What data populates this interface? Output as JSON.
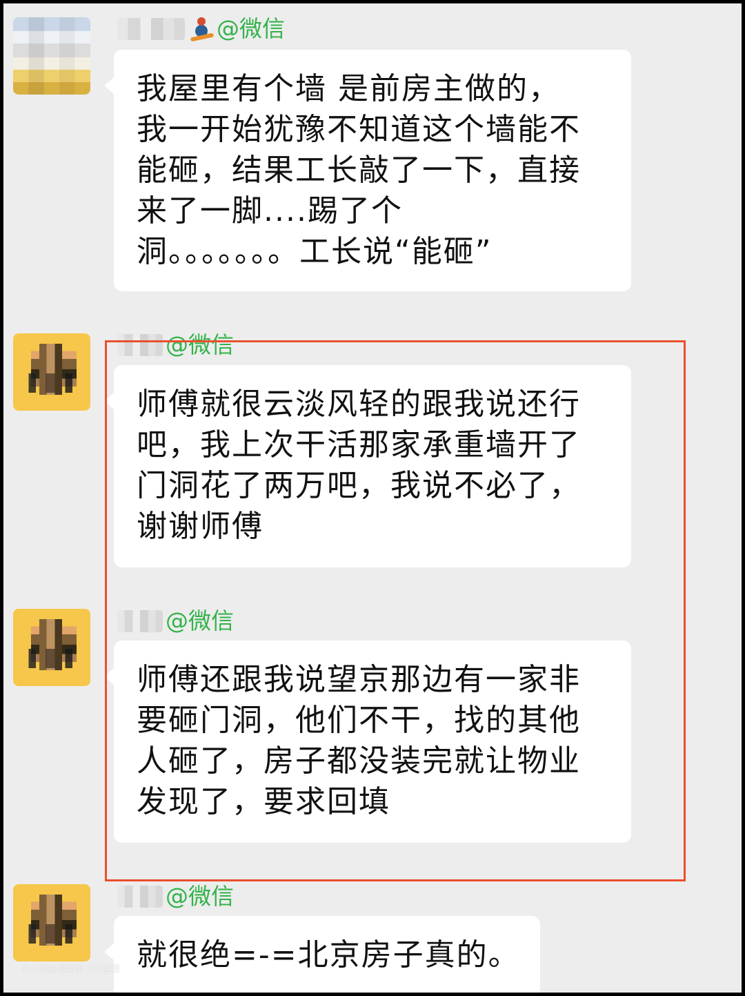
{
  "chat": {
    "wechat_tag": "@微信",
    "messages": [
      {
        "lines": [
          "我屋里有个墙 是前房主做的，",
          "我一开始犹豫不知道这个墙能不",
          "能砸，结果工长敲了一下，直接",
          "来了一脚....踢了个",
          "洞。。。。。。。工长说“能砸”"
        ]
      },
      {
        "lines": [
          "师傅就很云淡风轻的跟我说还行",
          "吧，我上次干活那家承重墙开了",
          "门洞花了两万吧，我说不必了，",
          "谢谢师傅"
        ]
      },
      {
        "lines": [
          "师傅还跟我说望京那边有一家非",
          "要砸门洞，他们不干，找的其他",
          "人砸了，房子都没装完就让物业",
          "发现了，要求回填"
        ]
      },
      {
        "lines": [
          "就很绝=-=北京房子真的。"
        ]
      }
    ]
  },
  "watermark": "住小帮@搭装第三方监理"
}
